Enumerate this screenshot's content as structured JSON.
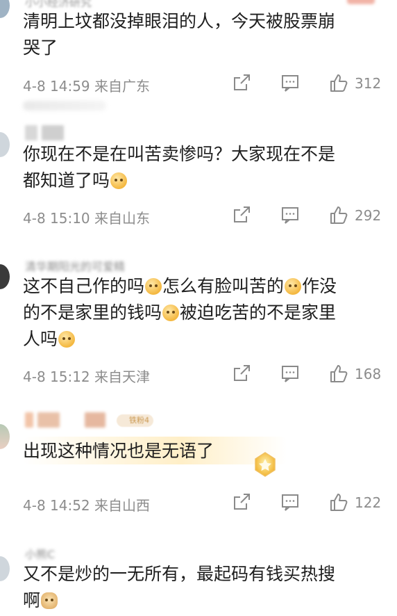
{
  "comments": [
    {
      "username": "小小经济研究",
      "text": "清明上坟都没掉眼泪的人，今天被股票崩\n哭了",
      "time": "4-8 14:59",
      "location": "来自广东",
      "likes": "312"
    },
    {
      "username": "",
      "text_a": "你现在不是在叫苦卖惨吗？大家现在不是\n都知道了吗",
      "time": "4-8 15:10",
      "location": "来自山东",
      "likes": "292"
    },
    {
      "username": "清华期阳光的可爱精",
      "text_a": "这不自己作的吗",
      "text_b": "怎么有脸叫苦的",
      "text_c": "作没\n的不是家里的钱吗",
      "text_d": "被迫吃苦的不是家里\n人吗",
      "time": "4-8 15:12",
      "location": "来自天津",
      "likes": "168"
    },
    {
      "fan_badge": "铁粉4",
      "text": "出现这种情况也是无语了",
      "time": "4-8 14:52",
      "location": "来自山西",
      "likes": "122"
    },
    {
      "username": "小熊C",
      "text_a": "又不是炒的一无所有，最起码有钱买热搜\n啊",
      "time": "",
      "location": "",
      "likes": ""
    }
  ],
  "icons": {
    "share": "share-icon",
    "reply": "comment-icon",
    "like": "thumbs-up-icon",
    "emoji_thinking": "thinking-emoji",
    "emoji_laugh": "laugh-cry-emoji",
    "emoji_doge": "doge-emoji"
  },
  "colors": {
    "text": "#1e1e1e",
    "meta": "#8c8c8c",
    "icon": "#8a8a8a"
  }
}
